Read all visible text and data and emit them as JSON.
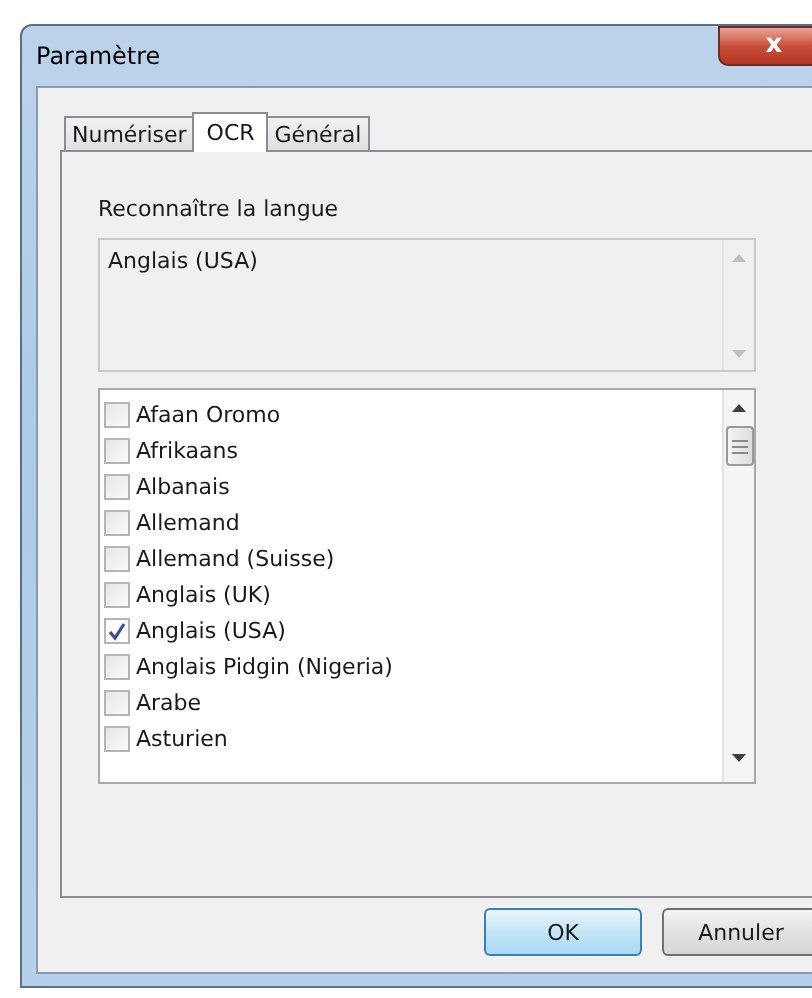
{
  "window": {
    "title": "Paramètre",
    "close": "x"
  },
  "tabs": [
    {
      "label": "Numériser",
      "selected": false
    },
    {
      "label": "OCR",
      "selected": true
    },
    {
      "label": "Général",
      "selected": false
    }
  ],
  "section_label": "Reconnaître la langue",
  "selected_languages": [
    "Anglais (USA)"
  ],
  "languages": [
    {
      "label": "Afaan Oromo",
      "checked": false
    },
    {
      "label": "Afrikaans",
      "checked": false
    },
    {
      "label": "Albanais",
      "checked": false
    },
    {
      "label": "Allemand",
      "checked": false
    },
    {
      "label": "Allemand (Suisse)",
      "checked": false
    },
    {
      "label": "Anglais (UK)",
      "checked": false
    },
    {
      "label": "Anglais (USA)",
      "checked": true
    },
    {
      "label": "Anglais Pidgin (Nigeria)",
      "checked": false
    },
    {
      "label": "Arabe",
      "checked": false
    },
    {
      "label": "Asturien",
      "checked": false
    }
  ],
  "buttons": [
    {
      "label": "OK",
      "kind": "default"
    },
    {
      "label": "Annuler",
      "kind": "normal"
    }
  ]
}
